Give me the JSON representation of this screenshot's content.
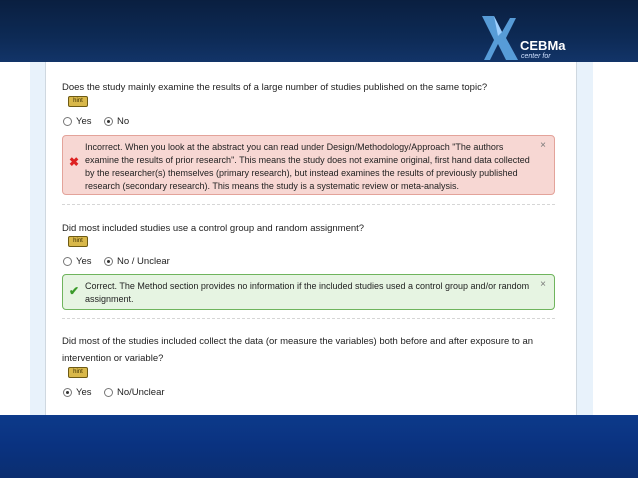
{
  "brand": {
    "name": "CEBMa",
    "subtitle": "center for"
  },
  "hint_label": "hint",
  "questions": [
    {
      "text": "Does the study mainly examine the results of a large number of studies published on the same topic?",
      "options": [
        "Yes",
        "No"
      ],
      "selected": "No",
      "feedback": {
        "status": "Incorrect",
        "text": "Incorrect. When you look at the abstract you can read under Design/Methodology/Approach \"The authors examine the results of prior research\". This means the study does not examine original, first hand data collected by the researcher(s) themselves (primary research), but instead examines the results of previously published research (secondary research). This means the study is a systematic review or meta-analysis."
      }
    },
    {
      "text": "Did most included studies use a control group and random assignment?",
      "options": [
        "Yes",
        "No / Unclear"
      ],
      "selected": "No / Unclear",
      "feedback": {
        "status": "Correct",
        "text": "Correct. The Method section provides no information if the included studies used a control group and/or random assignment."
      }
    },
    {
      "text": "Did most of the studies included collect the data (or measure the variables) both before and after exposure to an intervention or variable?",
      "options": [
        "Yes",
        "No/Unclear"
      ],
      "selected": "Yes"
    }
  ],
  "close_symbol": "×",
  "colors": {
    "header": "#0d2a55",
    "footer": "#0a3280",
    "error_bg": "#f7d7d3",
    "success_bg": "#e6f4e2",
    "error_mark": "#d22",
    "success_mark": "#3a9a2a"
  }
}
